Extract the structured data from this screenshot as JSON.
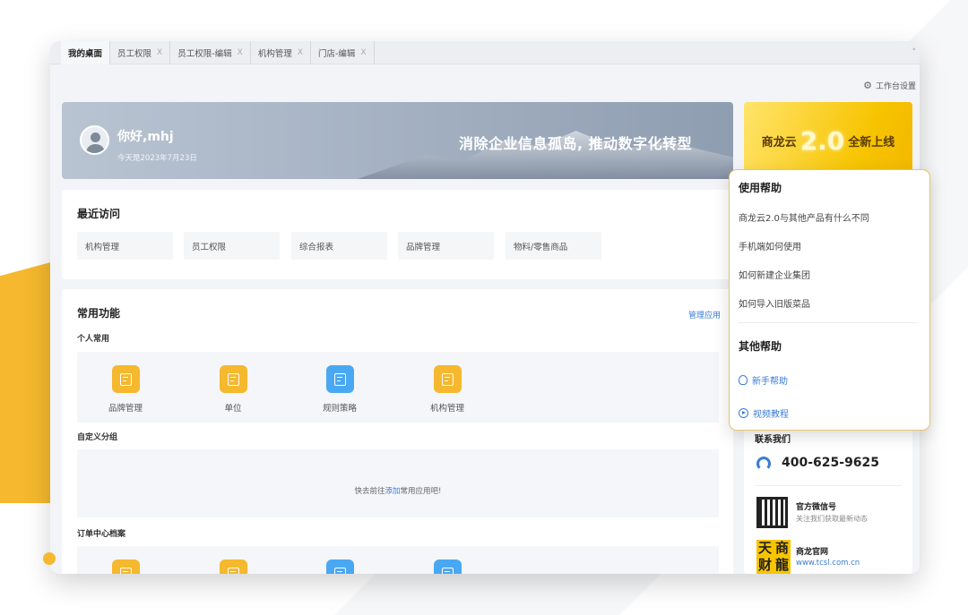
{
  "tabs": [
    {
      "label": "我的桌面",
      "close": ""
    },
    {
      "label": "员工权限",
      "close": "X"
    },
    {
      "label": "员工权限-编辑",
      "close": "X"
    },
    {
      "label": "机构管理",
      "close": "X"
    },
    {
      "label": "门店-编辑",
      "close": "X"
    }
  ],
  "workbench_settings": "工作台设置",
  "banner": {
    "greeting": "你好,mhj",
    "date": "今天是2023年7月23日",
    "slogan": "消除企业信息孤岛, 推动数字化转型"
  },
  "recent": {
    "title": "最近访问",
    "items": [
      "机构管理",
      "员工权限",
      "综合报表",
      "品牌管理",
      "物料/零售商品"
    ]
  },
  "common": {
    "title": "常用功能",
    "manage": "管理应用",
    "personal_title": "个人常用",
    "personal_apps": [
      "品牌管理",
      "单位",
      "规则策略",
      "机构管理"
    ],
    "custom_title": "自定义分组",
    "empty_prefix": "快去前往",
    "empty_link": "添加",
    "empty_suffix": "常用应用吧!",
    "order_title": "订单中心档案"
  },
  "promo": {
    "left": "商龙云",
    "version": "2.0",
    "right": "全新上线"
  },
  "help": {
    "title": "使用帮助",
    "questions": [
      "商龙云2.0与其他产品有什么不同",
      "手机端如何使用",
      "如何新建企业集团",
      "如何导入旧版菜品"
    ],
    "other_title": "其他帮助",
    "links": [
      "新手帮助",
      "视频教程"
    ]
  },
  "contact": {
    "title": "联系我们",
    "phone": "400-625-9625",
    "wechat_title": "官方微信号",
    "wechat_sub": "关注我们获取最新动态",
    "logo_chars": [
      "天",
      "商",
      "财",
      "龍"
    ],
    "site_title": "商龙官网",
    "site_url": "www.tcsl.com.cn"
  },
  "colors": {
    "accent": "#3a7bd5",
    "brand_yellow": "#f7c400",
    "app_orange": "#f5b82e",
    "app_blue": "#4aa8f2"
  }
}
